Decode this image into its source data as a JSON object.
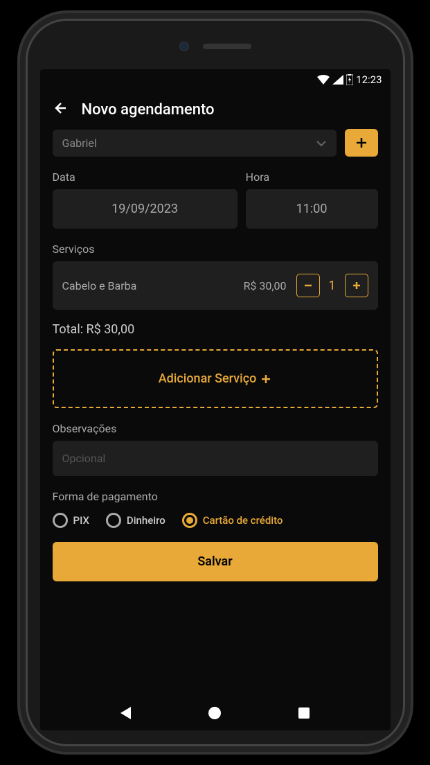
{
  "status_bar": {
    "time": "12:23"
  },
  "header": {
    "title": "Novo agendamento"
  },
  "client": {
    "selected": "Gabriel"
  },
  "date": {
    "label": "Data",
    "value": "19/09/2023"
  },
  "time": {
    "label": "Hora",
    "value": "11:00"
  },
  "services": {
    "label": "Serviços",
    "items": [
      {
        "name": "Cabelo e Barba",
        "price": "R$ 30,00",
        "quantity": "1"
      }
    ]
  },
  "total": {
    "label": "Total: R$ 30,00"
  },
  "add_service": {
    "label": "Adicionar Serviço"
  },
  "observations": {
    "label": "Observações",
    "placeholder": "Opcional"
  },
  "payment": {
    "label": "Forma de pagamento",
    "options": {
      "pix": "PIX",
      "cash": "Dinheiro",
      "credit": "Cartão de crédito"
    },
    "selected": "credit"
  },
  "save_button": {
    "label": "Salvar"
  }
}
